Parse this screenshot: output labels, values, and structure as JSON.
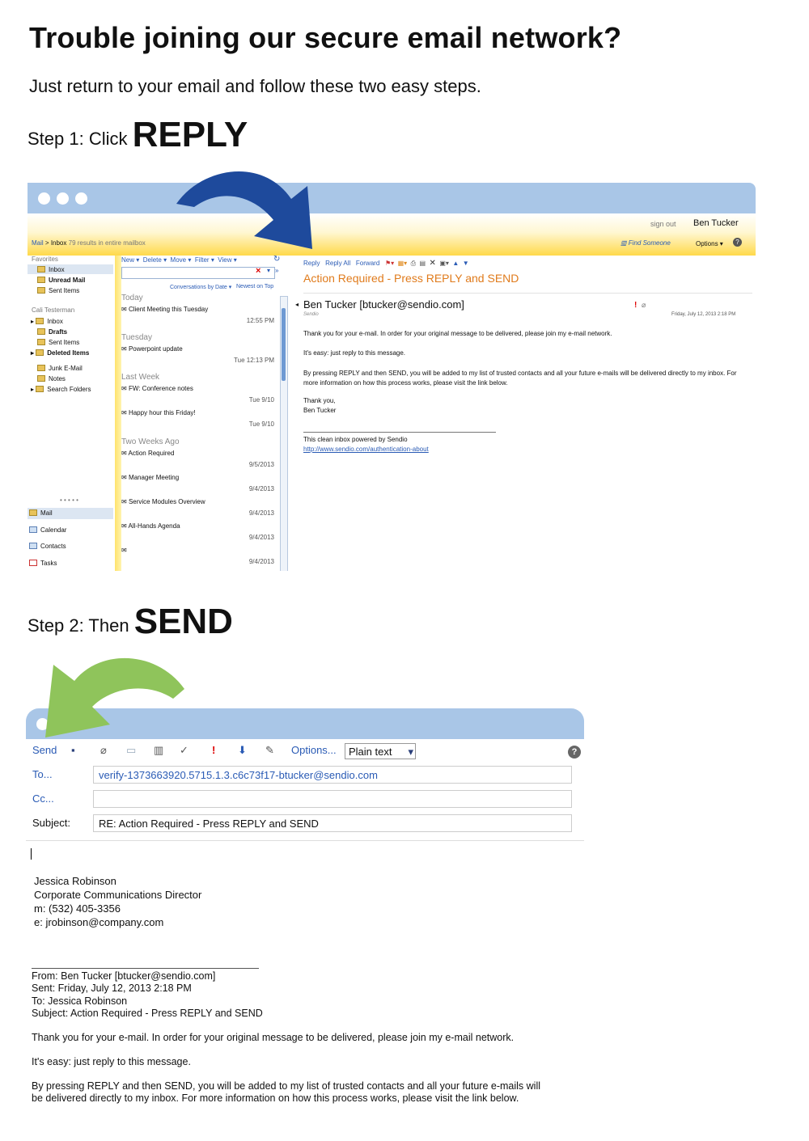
{
  "heading": "Trouble joining our secure email network?",
  "intro": "Just return to your email and follow these two easy steps.",
  "step1": {
    "prefix": "Step 1: Click ",
    "action": "REPLY"
  },
  "step2": {
    "prefix": "Step 2: Then ",
    "action": "SEND"
  },
  "colors": {
    "arrow1": "#1e4a9c",
    "arrow2": "#8fc45b",
    "bar": "#a9c6e7",
    "accent": "#e07b1c"
  },
  "outlook": {
    "sign_out": "sign out",
    "user": "Ben Tucker",
    "breadcrumb": {
      "mail": "Mail",
      "sep": ">",
      "inbox": "Inbox",
      "count": "79 results in entire mailbox"
    },
    "find_someone": "Find Someone",
    "options": "Options",
    "sidebar": {
      "favorites": "Favorites",
      "fav_items": [
        "Inbox",
        "Unread Mail",
        "Sent Items"
      ],
      "account": "Cali Testerman",
      "folders": [
        "Inbox",
        "Drafts",
        "Sent Items",
        "Deleted Items",
        "Junk E-Mail",
        "Notes",
        "Search Folders"
      ],
      "nav": [
        "Mail",
        "Calendar",
        "Contacts",
        "Tasks"
      ]
    },
    "toolbar": [
      "New",
      "Delete",
      "Move",
      "Filter",
      "View"
    ],
    "sort": {
      "by": "Conversations by Date",
      "order": "Newest on Top"
    },
    "groups": {
      "today": "Today",
      "tuesday": "Tuesday",
      "last_week": "Last Week",
      "two_weeks": "Two Weeks Ago"
    },
    "messages": [
      {
        "subject": "Client Meeting this Tuesday",
        "date": "12:55 PM"
      },
      {
        "subject": "Powerpoint update",
        "date": "Tue 12:13 PM"
      },
      {
        "subject": "FW: Conference notes",
        "date": "Tue 9/10"
      },
      {
        "subject": "Happy hour this Friday!",
        "date": "Tue 9/10"
      },
      {
        "subject": "Action Required",
        "date": "9/5/2013"
      },
      {
        "subject": "Manager Meeting",
        "date": "9/4/2013"
      },
      {
        "subject": "Service Modules Overview",
        "date": "9/4/2013"
      },
      {
        "subject": "All-Hands Agenda",
        "date": "9/4/2013"
      },
      {
        "subject": "",
        "date": "9/4/2013"
      }
    ],
    "reading": {
      "actions": [
        "Reply",
        "Reply All",
        "Forward"
      ],
      "subject": "Action Required - Press REPLY and SEND",
      "from": "Ben Tucker [btucker@sendio.com]",
      "org": "Sendio",
      "date": "Friday, July 12, 2013 2:18 PM",
      "p1": "Thank you for your e-mail. In order for your original message to be delivered, please join my e-mail network.",
      "p2": "It's easy: just reply to this message.",
      "p3": "By pressing REPLY and then SEND, you will be added to my list of trusted contacts and all your future e-mails will be delivered directly to my inbox. For more information on how this process works, please visit the link below.",
      "thanks": "Thank you,",
      "name": "Ben Tucker",
      "powered": "This clean inbox powered by Sendio",
      "link": "http://www.sendio.com/authentication-about"
    }
  },
  "compose": {
    "send": "Send",
    "options": "Options...",
    "format": "Plain text",
    "to_label": "To...",
    "to_value": "verify-1373663920.5715.1.3.c6c73f17-btucker@sendio.com",
    "cc_label": "Cc...",
    "subject_label": "Subject:",
    "subject_value": "RE: Action Required - Press REPLY and SEND",
    "signature": [
      "Jessica Robinson",
      "Corporate Communications Director",
      "m: (532) 405-3356",
      "e: jrobinson@company.com"
    ],
    "quoted_header": [
      "From: Ben Tucker [btucker@sendio.com]",
      "Sent: Friday, July 12, 2013 2:18 PM",
      "To: Jessica Robinson",
      "Subject: Action Required - Press REPLY and SEND"
    ],
    "quoted_p1": "Thank you for your e-mail. In order for your original message to be delivered, please join my e-mail network.",
    "quoted_p2": "It's easy: just reply to this message.",
    "quoted_p3a": "By pressing REPLY and then SEND, you will be added to my list of trusted contacts and all your future e-mails will",
    "quoted_p3b": "be delivered directly to my inbox. For more information on how this process works, please visit the link below."
  }
}
